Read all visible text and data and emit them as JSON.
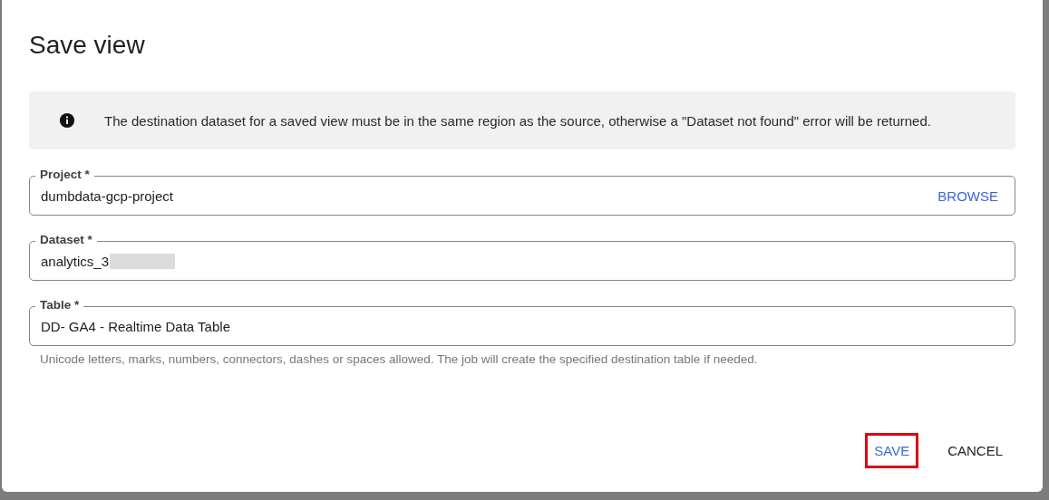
{
  "dialog": {
    "title": "Save view",
    "notice": {
      "text": "The destination dataset for a saved view must be in the same region as the source, otherwise a \"Dataset not found\" error will be returned."
    },
    "fields": [
      {
        "label": "Project *",
        "value": "dumbdata-gcp-project",
        "action": "BROWSE",
        "redacted": false
      },
      {
        "label": "Dataset *",
        "value": "analytics_3",
        "redacted": true
      },
      {
        "label": "Table *",
        "value": "DD- GA4 - Realtime Data Table",
        "redacted": false
      }
    ],
    "hint": "Unicode letters, marks, numbers, connectors, dashes or spaces allowed. The job will create the specified destination table if needed.",
    "buttons": [
      {
        "label": "SAVE",
        "kind": "primary",
        "highlighted": true
      },
      {
        "label": "CANCEL",
        "kind": "plain",
        "highlighted": false
      }
    ]
  }
}
